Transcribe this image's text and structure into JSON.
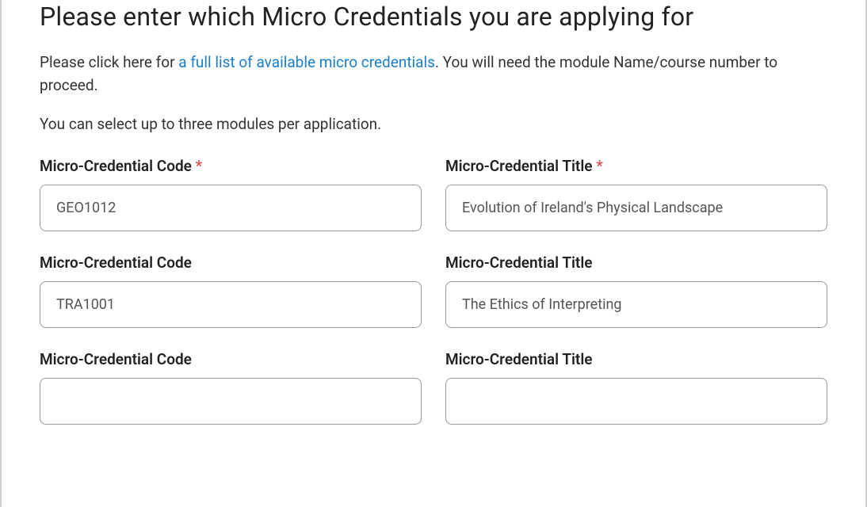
{
  "heading": "Please enter which Micro Credentials you are applying for",
  "intro": {
    "prefix": "Please click here for ",
    "link_text": "a full list of available micro credentials",
    "suffix": ". You will need the module Name/course number to proceed."
  },
  "note": "You can select up to three modules per application.",
  "required_mark": "*",
  "fields": {
    "row1": {
      "code_label": "Micro-Credential Code ",
      "code_value": "GEO1012",
      "title_label": "Micro-Credential Title ",
      "title_value": "Evolution of Ireland's Physical Landscape"
    },
    "row2": {
      "code_label": "Micro-Credential Code",
      "code_value": "TRA1001",
      "title_label": "Micro-Credential Title",
      "title_value": "The Ethics of Interpreting"
    },
    "row3": {
      "code_label": "Micro-Credential Code",
      "code_value": "",
      "title_label": "Micro-Credential Title",
      "title_value": ""
    }
  }
}
